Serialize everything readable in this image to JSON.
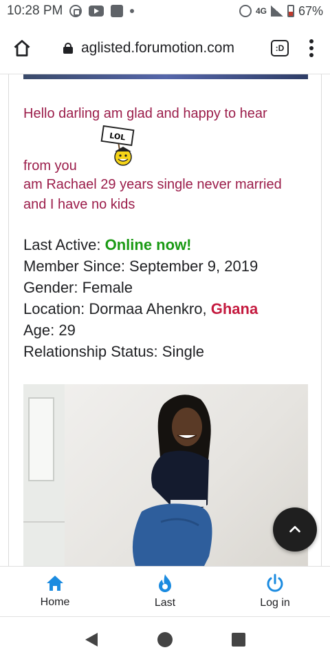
{
  "status_bar": {
    "time": "10:28 PM",
    "network": "4G",
    "battery": "67%",
    "icons": [
      "whatsapp-icon",
      "youtube-icon",
      "app-icon",
      "notification-dot-icon",
      "alarm-icon",
      "signal-icon",
      "battery-icon"
    ]
  },
  "browser": {
    "url": "aglisted.forumotion.com",
    "tab_count": ":D",
    "icons": [
      "home-icon",
      "lock-icon",
      "tab-switcher-icon",
      "menu-icon"
    ]
  },
  "post": {
    "message_line1": "Hello darling am glad and happy to hear",
    "lol_sign": "LOL",
    "message_line2": "from you",
    "message_line3": "am Rachael 29 years single never married",
    "message_line4": "and I have no kids"
  },
  "profile": {
    "last_active_label": "Last Active: ",
    "last_active_value": "Online now!",
    "member_since": "Member Since: September 9, 2019",
    "gender": "Gender: Female",
    "location_label": "Location: Dormaa Ahenkro, ",
    "location_country": "Ghana",
    "age": "Age: 29",
    "relationship": "Relationship Status: Single"
  },
  "bottom_nav": {
    "items": [
      {
        "label": "Home",
        "icon": "home-icon"
      },
      {
        "label": "Last",
        "icon": "fire-icon"
      },
      {
        "label": "Log in",
        "icon": "power-icon"
      }
    ]
  },
  "colors": {
    "message": "#9b1d4a",
    "online": "#1a9a14",
    "country": "#c4193e",
    "nav_accent": "#1b8be0"
  }
}
